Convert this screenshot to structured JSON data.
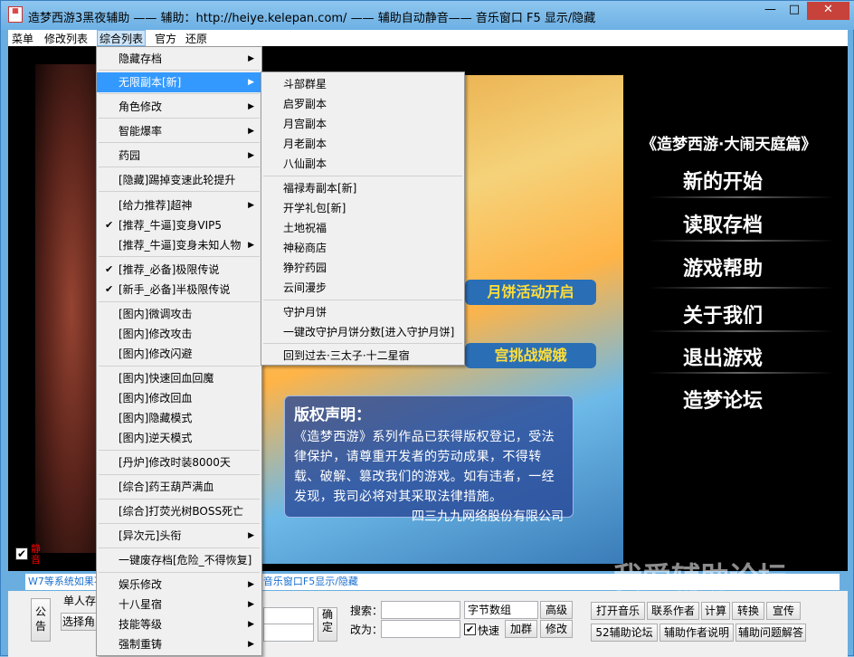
{
  "window": {
    "title": "造梦西游3黑夜辅助 —— 辅助：http://heiye.kelepan.com/ —— 辅助自动静音—— 音乐窗口 F5 显示/隐藏",
    "controls": {
      "minimize": "—",
      "maximize": "□",
      "close": "✕"
    }
  },
  "menubar": [
    "菜单",
    "修改列表",
    "综合列表",
    "官方",
    "还原"
  ],
  "menu_main": [
    {
      "label": "隐藏存档",
      "submenu": true
    },
    {
      "label": "无限副本[新]",
      "submenu": true,
      "selected": true
    },
    {
      "label": "角色修改",
      "submenu": true
    },
    {
      "label": "智能爆率",
      "submenu": true
    },
    {
      "label": "药园",
      "submenu": true
    },
    {
      "label": "[隐藏]踢掉变速此轮提升"
    },
    {
      "label": "[给力推荐]超神",
      "submenu": true
    },
    {
      "label": "[推荐_牛逼]变身VIP5",
      "checked": true
    },
    {
      "label": "[推荐_牛逼]变身未知人物",
      "submenu": true
    },
    {
      "label": "[推荐_必备]极限传说",
      "checked": true
    },
    {
      "label": "[新手_必备]半极限传说",
      "checked": true
    },
    {
      "label": "[图内]微调攻击"
    },
    {
      "label": "[图内]修改攻击"
    },
    {
      "label": "[图内]修改闪避"
    },
    {
      "label": "[图内]快速回血回魔"
    },
    {
      "label": "[图内]修改回血"
    },
    {
      "label": "[图内]隐藏模式"
    },
    {
      "label": "[图内]逆天模式"
    },
    {
      "label": "[丹炉]修改时装8000天"
    },
    {
      "label": "[综合]药王葫芦满血"
    },
    {
      "label": "[综合]打荧光树BOSS死亡"
    },
    {
      "label": "[异次元]头衔",
      "submenu": true
    },
    {
      "label": "一键废存档[危险_不得恢复]"
    },
    {
      "label": "娱乐修改",
      "submenu": true
    },
    {
      "label": "十八星宿",
      "submenu": true
    },
    {
      "label": "技能等级",
      "submenu": true
    },
    {
      "label": "强制重铸",
      "submenu": true
    }
  ],
  "menu_sub": [
    "斗部群星",
    "启罗副本",
    "月宫副本",
    "月老副本",
    "八仙副本",
    "福禄寿副本[新]",
    "开学礼包[新]",
    "土地祝福",
    "神秘商店",
    "狰狞药园",
    "云间漫步",
    "守护月饼",
    "一键改守护月饼分数[进入守护月饼]",
    "回到过去·三太子·十二星宿"
  ],
  "game": {
    "title": "《造梦西游·大闹天庭篇》",
    "menu": [
      "新的开始",
      "读取存档",
      "游戏帮助",
      "关于我们",
      "退出游戏",
      "造梦论坛"
    ],
    "banners": [
      "月饼活动开启",
      "宫挑战嫦娥"
    ],
    "copyright_title": "版权声明：",
    "copyright_body": "《造梦西游》系列作品已获得版权登记，受法律保护，请尊重开发者的劳动成果，不得转载、破解、篡改我们的游戏。如有违者，一经发现，我司必将对其采取法律措施。",
    "copyright_sig": "四三九九网络股份有限公司"
  },
  "mute_label": "静音",
  "status_text": "W7等系统如果不能静音，请打开网页静音可以使用，音乐窗口F5显示/隐藏",
  "watermark": "我爱辅助论坛",
  "panel": {
    "notice": "公告",
    "single_label": "单人存",
    "select_label": "选择角",
    "confirm": "确定",
    "search_label": "搜索：",
    "change_label": "改为：",
    "combo": "字节数组",
    "advanced": "高级",
    "modify": "修改",
    "fast": "快速",
    "add_group": "加群",
    "buttons": [
      "打开音乐",
      "联系作者",
      "计算",
      "转换",
      "宣传",
      "52辅助论坛",
      "辅助作者说明",
      "辅助问题解答"
    ]
  }
}
